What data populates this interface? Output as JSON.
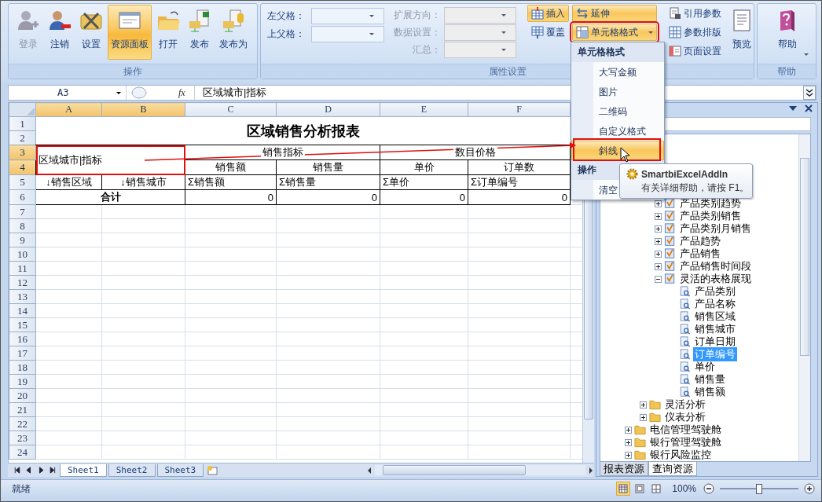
{
  "ribbon": {
    "operations": {
      "label": "操作",
      "buttons": [
        {
          "label": "登录",
          "kind": "login",
          "disabled": true,
          "selected": false
        },
        {
          "label": "注销",
          "kind": "logout",
          "disabled": false,
          "selected": false
        },
        {
          "label": "设置",
          "kind": "settings",
          "disabled": false,
          "selected": false
        },
        {
          "label": "资源面板",
          "kind": "panel",
          "disabled": false,
          "selected": true
        },
        {
          "label": "打开",
          "kind": "open",
          "disabled": false,
          "selected": false
        },
        {
          "label": "发布",
          "kind": "publish",
          "disabled": false,
          "selected": false
        },
        {
          "label": "发布为",
          "kind": "publishas",
          "disabled": false,
          "selected": false
        }
      ]
    },
    "properties": {
      "label": "属性设置",
      "fields": [
        {
          "label": "左父格：",
          "disabled": false
        },
        {
          "label": "上父格：",
          "disabled": false
        },
        {
          "label": "扩展方向：",
          "disabled": true
        },
        {
          "label": "数据设置：",
          "disabled": true
        },
        {
          "label": "汇总：",
          "disabled": true
        }
      ],
      "small_buttons": [
        {
          "label": "插入",
          "kind": "insert",
          "selected": true
        },
        {
          "label": "覆盖",
          "kind": "cover",
          "selected": false
        },
        {
          "label": "延伸",
          "kind": "extend",
          "selected": true
        },
        {
          "label": "单元格格式",
          "kind": "format",
          "selected": true
        },
        {
          "label": "引用参数",
          "kind": "param",
          "selected": false
        },
        {
          "label": "参数排版",
          "kind": "grid",
          "selected": false
        },
        {
          "label": "页面设置",
          "kind": "page",
          "selected": false
        }
      ],
      "preview": "预览"
    },
    "help": {
      "label": "帮助",
      "button": "帮助"
    }
  },
  "formula_bar": {
    "name_box": "A3",
    "function_symbol": "fx",
    "formula": "区域城市|指标"
  },
  "sheet": {
    "columns": [
      {
        "label": "A",
        "selected": true
      },
      {
        "label": "B",
        "selected": true
      },
      {
        "label": "C",
        "selected": false
      },
      {
        "label": "D",
        "selected": false
      },
      {
        "label": "E",
        "selected": false
      },
      {
        "label": "F",
        "selected": false
      }
    ],
    "rows": [
      {
        "number": "1",
        "selected": false,
        "kind": "data",
        "cells": [
          {
            "text": "区域销售分析报表",
            "kind": "title",
            "colspan": 6,
            "rowspan": 2
          }
        ]
      },
      {
        "number": "2",
        "selected": false,
        "kind": "covered"
      },
      {
        "number": "3",
        "selected": true,
        "kind": "data",
        "cells": [
          {
            "text": "区域城市|指标",
            "kind": "label",
            "colspan": 2,
            "rowspan": 2
          },
          {
            "text": "销售指标",
            "kind": "header",
            "colspan": 2
          },
          {
            "text": "数目价格",
            "kind": "header",
            "colspan": 2
          }
        ]
      },
      {
        "number": "4",
        "selected": true,
        "kind": "data",
        "cells": [
          {
            "text": "销售额",
            "kind": "header"
          },
          {
            "text": "销售量",
            "kind": "header"
          },
          {
            "text": "单价",
            "kind": "header"
          },
          {
            "text": "订单数",
            "kind": "header"
          }
        ]
      },
      {
        "number": "5",
        "selected": false,
        "kind": "data",
        "cells": [
          {
            "text": "↓销售区域",
            "kind": "header"
          },
          {
            "text": "↓销售城市",
            "kind": "header"
          },
          {
            "text": "Σ销售额",
            "kind": "field"
          },
          {
            "text": "Σ销售量",
            "kind": "field"
          },
          {
            "text": "Σ单价",
            "kind": "field"
          },
          {
            "text": "Σ订单编号",
            "kind": "field"
          }
        ]
      },
      {
        "number": "6",
        "selected": false,
        "kind": "data",
        "cells": [
          {
            "text": "合计",
            "kind": "total",
            "colspan": 2
          },
          {
            "text": "0",
            "kind": "number"
          },
          {
            "text": "0",
            "kind": "number"
          },
          {
            "text": "0",
            "kind": "number"
          },
          {
            "text": "0",
            "kind": "number"
          }
        ]
      },
      {
        "number": "7",
        "selected": false,
        "kind": "blank"
      },
      {
        "number": "8",
        "selected": false,
        "kind": "blank"
      },
      {
        "number": "9",
        "selected": false,
        "kind": "blank"
      },
      {
        "number": "10",
        "selected": false,
        "kind": "blank"
      },
      {
        "number": "11",
        "selected": false,
        "kind": "blank"
      },
      {
        "number": "12",
        "selected": false,
        "kind": "blank"
      },
      {
        "number": "13",
        "selected": false,
        "kind": "blank"
      },
      {
        "number": "14",
        "selected": false,
        "kind": "blank"
      },
      {
        "number": "15",
        "selected": false,
        "kind": "blank"
      },
      {
        "number": "16",
        "selected": false,
        "kind": "blank"
      },
      {
        "number": "17",
        "selected": false,
        "kind": "blank"
      },
      {
        "number": "18",
        "selected": false,
        "kind": "blank"
      },
      {
        "number": "19",
        "selected": false,
        "kind": "blank"
      },
      {
        "number": "20",
        "selected": false,
        "kind": "blank"
      },
      {
        "number": "21",
        "selected": false,
        "kind": "blank"
      },
      {
        "number": "22",
        "selected": false,
        "kind": "blank"
      },
      {
        "number": "23",
        "selected": false,
        "kind": "blank"
      },
      {
        "number": "24",
        "selected": false,
        "kind": "blank"
      }
    ],
    "tabs": [
      {
        "label": "Sheet1",
        "selected": true
      },
      {
        "label": "Sheet2",
        "selected": false
      },
      {
        "label": "Sheet3",
        "selected": false
      }
    ]
  },
  "menu": {
    "sections": [
      {
        "title": "单元格格式",
        "items": [
          {
            "label": "大写金额",
            "selected": false
          },
          {
            "label": "图片",
            "selected": false
          },
          {
            "label": "二维码",
            "selected": false
          },
          {
            "label": "自定义格式",
            "selected": false
          },
          {
            "label": "斜线",
            "selected": true
          }
        ]
      },
      {
        "title": "操作",
        "items": [
          {
            "label": "清空",
            "selected": false
          }
        ]
      }
    ]
  },
  "tooltip": {
    "title": "SmartbiExcelAddIn",
    "text": "有关详细帮助，请按 F1。"
  },
  "task_pane": {
    "tree": {
      "nodes": [
        {
          "children": [
            {
              "children": [
                {
                  "label": "产品类别趋势",
                  "kind": "report",
                  "expanded": false,
                  "selected": false
                },
                {
                  "label": "产品类别销售",
                  "kind": "report",
                  "expanded": false,
                  "selected": false
                },
                {
                  "label": "产品类别月销售",
                  "kind": "report",
                  "expanded": false,
                  "selected": false
                },
                {
                  "label": "产品趋势",
                  "kind": "report",
                  "expanded": false,
                  "selected": false
                },
                {
                  "label": "产品销售",
                  "kind": "report",
                  "expanded": false,
                  "selected": false
                },
                {
                  "label": "产品销售时间段",
                  "kind": "report",
                  "expanded": false,
                  "selected": false
                },
                {
                  "label": "灵活的表格展现",
                  "kind": "report",
                  "expanded": true,
                  "selected": false,
                  "children": [
                    {
                      "label": "产品类别",
                      "kind": "field",
                      "selected": false
                    },
                    {
                      "label": "产品名称",
                      "kind": "field",
                      "selected": false
                    },
                    {
                      "label": "销售区域",
                      "kind": "field",
                      "selected": false
                    },
                    {
                      "label": "销售城市",
                      "kind": "field",
                      "selected": false
                    },
                    {
                      "label": "订单日期",
                      "kind": "field",
                      "selected": false
                    },
                    {
                      "label": "订单编号",
                      "kind": "field",
                      "selected": true
                    },
                    {
                      "label": "单价",
                      "kind": "field",
                      "selected": false
                    },
                    {
                      "label": "销售量",
                      "kind": "field",
                      "selected": false
                    },
                    {
                      "label": "销售额",
                      "kind": "field",
                      "selected": false
                    }
                  ]
                }
              ]
            },
            {
              "label": "灵活分析",
              "kind": "folder",
              "expanded": false,
              "selected": false
            },
            {
              "label": "仪表分析",
              "kind": "folder",
              "expanded": false,
              "selected": false
            }
          ]
        },
        {
          "label": "电信管理驾驶舱",
          "kind": "folder",
          "expanded": false,
          "selected": false
        },
        {
          "label": "银行管理驾驶舱",
          "kind": "folder",
          "expanded": false,
          "selected": false
        },
        {
          "label": "银行风险监控",
          "kind": "folder",
          "expanded": false,
          "selected": false
        }
      ]
    },
    "tabs": [
      {
        "label": "报表资源",
        "selected": false
      },
      {
        "label": "查询资源",
        "selected": true
      }
    ]
  },
  "status_bar": {
    "text": "就绪",
    "views": [
      {
        "kind": "normal",
        "selected": true
      },
      {
        "kind": "layout",
        "selected": false
      },
      {
        "kind": "pagebreak",
        "selected": false
      }
    ],
    "zoom": "100%",
    "zoom_slider": {
      "level": 0.5
    }
  }
}
